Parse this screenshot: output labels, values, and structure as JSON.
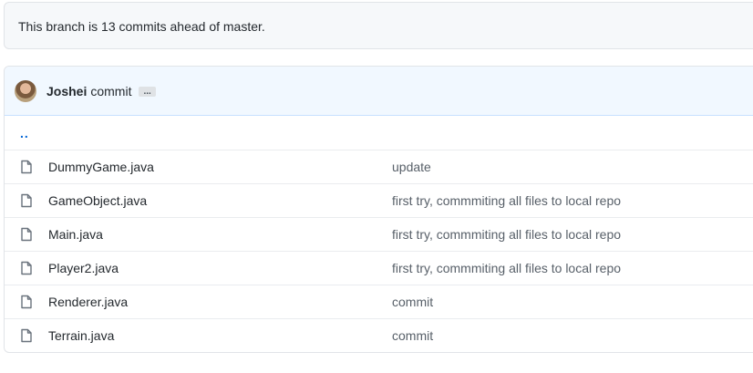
{
  "branch_status": {
    "text": "This branch is 13 commits ahead of master."
  },
  "latest_commit": {
    "author": "Joshei",
    "message": "commit",
    "ellipsis": "..."
  },
  "parent_link": "..",
  "files": [
    {
      "name": "DummyGame.java",
      "commit_message": "update"
    },
    {
      "name": "GameObject.java",
      "commit_message": "first try, commmiting all files to local repo"
    },
    {
      "name": "Main.java",
      "commit_message": "first try, commmiting all files to local repo"
    },
    {
      "name": "Player2.java",
      "commit_message": "first try, commmiting all files to local repo"
    },
    {
      "name": "Renderer.java",
      "commit_message": "commit"
    },
    {
      "name": "Terrain.java",
      "commit_message": "commit"
    }
  ],
  "icons": {
    "file": "file-icon"
  },
  "colors": {
    "link": "#0366d6",
    "header_bg": "#f1f8ff",
    "branch_bg": "#f6f8fa"
  }
}
